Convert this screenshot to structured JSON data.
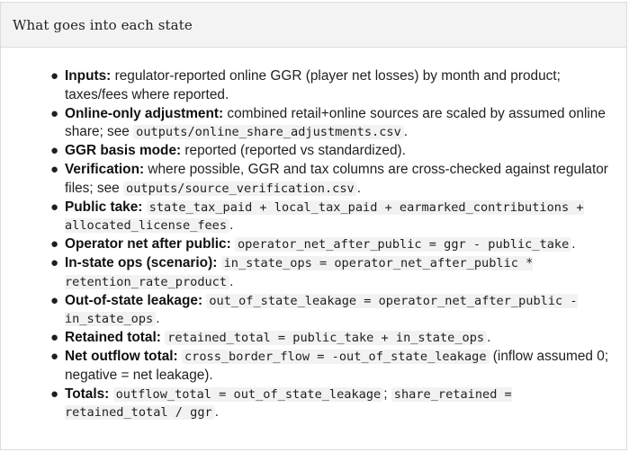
{
  "panel": {
    "title": "What goes into each state"
  },
  "items": [
    {
      "label": "Inputs:",
      "t1": " regulator-reported online GGR (player net losses) by month and product; taxes/fees where reported."
    },
    {
      "label": "Online-only adjustment:",
      "t1": " combined retail+online sources are scaled by assumed online share; see ",
      "c1": "outputs/online_share_adjustments.csv",
      "t2": "."
    },
    {
      "label": "GGR basis mode:",
      "t1": " reported (reported vs standardized)."
    },
    {
      "label": "Verification:",
      "t1": " where possible, GGR and tax columns are cross-checked against regulator files; see ",
      "c1": "outputs/source_verification.csv",
      "t2": "."
    },
    {
      "label": "Public take:",
      "t1": " ",
      "c1": "state_tax_paid + local_tax_paid + earmarked_contributions + allocated_license_fees",
      "t2": "."
    },
    {
      "label": "Operator net after public:",
      "t1": " ",
      "c1": "operator_net_after_public = ggr - public_take",
      "t2": "."
    },
    {
      "label": "In-state ops (scenario):",
      "t1": " ",
      "c1": "in_state_ops = operator_net_after_public * retention_rate_product",
      "t2": "."
    },
    {
      "label": "Out-of-state leakage:",
      "t1": " ",
      "c1": "out_of_state_leakage = operator_net_after_public - in_state_ops",
      "t2": "."
    },
    {
      "label": "Retained total:",
      "t1": " ",
      "c1": "retained_total = public_take + in_state_ops",
      "t2": "."
    },
    {
      "label": "Net outflow total:",
      "t1": " ",
      "c1": "cross_border_flow = -out_of_state_leakage",
      "t2": " (inflow assumed 0; negative = net leakage)."
    },
    {
      "label": "Totals:",
      "t1": " ",
      "c1": "outflow_total = out_of_state_leakage",
      "t2": "; ",
      "c2": "share_retained = retained_total / ggr",
      "t3": "."
    }
  ]
}
